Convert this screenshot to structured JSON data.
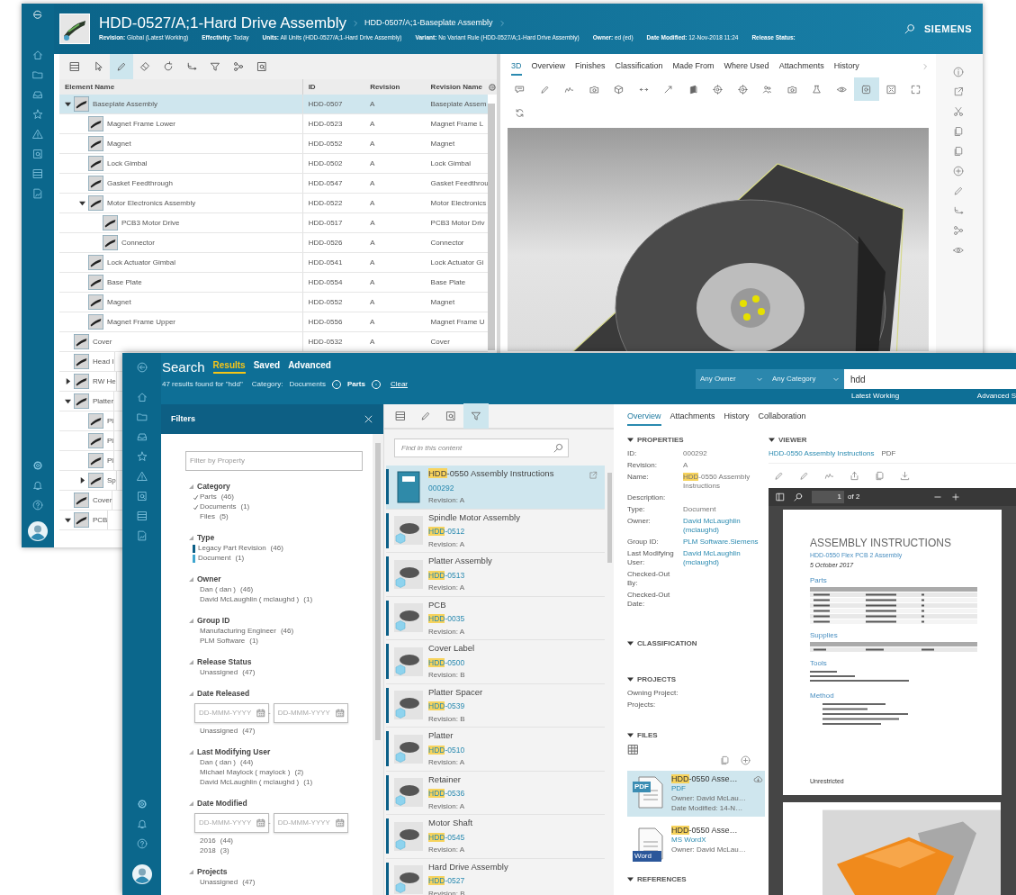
{
  "back_window": {
    "title": "HDD-0527/A;1-Hard Drive Assembly",
    "breadcrumb": "HDD-0507/A;1-Baseplate Assembly",
    "properties": [
      {
        "label": "Revision:",
        "value": "Global (Latest Working)"
      },
      {
        "label": "Effectivity:",
        "value": "Today"
      },
      {
        "label": "Units:",
        "value": "All Units (HDD-0527/A;1-Hard Drive Assembly)"
      },
      {
        "label": "Variant:",
        "value": "No Variant Rule (HDD-0527/A;1-Hard Drive Assembly)"
      },
      {
        "label": "Owner:",
        "value": "ed (ed)"
      },
      {
        "label": "Date Modified:",
        "value": "12-Nov-2018 11:24"
      },
      {
        "label": "Release Status:"
      }
    ],
    "brand": "SIEMENS",
    "toolbar": [
      {
        "selected": false
      },
      {
        "selected": false
      },
      {
        "selected": true
      },
      {
        "selected": false
      },
      {
        "selected": false
      },
      {
        "selected": false
      },
      {
        "selected": false
      },
      {
        "selected": false
      },
      {
        "selected": false
      }
    ],
    "table": {
      "columns": [
        "Element Name",
        "ID",
        "Revision",
        "Revision Name"
      ],
      "rows": [
        {
          "name": "Baseplate Assembly",
          "id": "HDD-0507",
          "revision": "A",
          "revision_name": "Baseplate Assem",
          "selected": true,
          "expanded": true,
          "children": [
            {
              "name": "Magnet Frame Lower",
              "id": "HDD-0523",
              "revision": "A",
              "revision_name": "Magnet Frame L",
              "selected": false
            },
            {
              "name": "Magnet",
              "id": "HDD-0552",
              "revision": "A",
              "revision_name": "Magnet",
              "selected": false
            },
            {
              "name": "Lock Gimbal",
              "id": "HDD-0502",
              "revision": "A",
              "revision_name": "Lock Gimbal",
              "selected": false
            },
            {
              "name": "Gasket Feedthrough",
              "id": "HDD-0547",
              "revision": "A",
              "revision_name": "Gasket Feedthrou",
              "selected": false
            },
            {
              "name": "Motor Electronics Assembly",
              "id": "HDD-0522",
              "revision": "A",
              "revision_name": "Motor Electronics",
              "selected": false,
              "expanded": true,
              "children": [
                {
                  "name": "PCB3 Motor Drive",
                  "id": "HDD-0517",
                  "revision": "A",
                  "revision_name": "PCB3 Motor Driv",
                  "selected": false
                },
                {
                  "name": "Connector",
                  "id": "HDD-0526",
                  "revision": "A",
                  "revision_name": "Connector",
                  "selected": false
                }
              ]
            },
            {
              "name": "Lock Actuator Gimbal",
              "id": "HDD-0541",
              "revision": "A",
              "revision_name": "Lock Actuator Gi",
              "selected": false
            },
            {
              "name": "Base Plate",
              "id": "HDD-0554",
              "revision": "A",
              "revision_name": "Base Plate",
              "selected": false
            },
            {
              "name": "Magnet",
              "id": "HDD-0552",
              "revision": "A",
              "revision_name": "Magnet",
              "selected": false
            },
            {
              "name": "Magnet Frame Upper",
              "id": "HDD-0556",
              "revision": "A",
              "revision_name": "Magnet Frame U",
              "selected": false
            }
          ]
        },
        {
          "name": "Cover",
          "id": "HDD-0532",
          "revision": "A",
          "revision_name": "Cover",
          "selected": false
        },
        {
          "name": "Head I",
          "selected": false
        },
        {
          "name": "RW He",
          "selected": false,
          "expanded": false
        },
        {
          "name": "Platter",
          "selected": false,
          "expanded": true,
          "children": [
            {
              "name": "Pl",
              "selected": false
            },
            {
              "name": "Pl",
              "selected": false
            },
            {
              "name": "Pl",
              "selected": false
            },
            {
              "name": "Sp",
              "selected": false,
              "expanded": false
            }
          ]
        },
        {
          "name": "Cover",
          "selected": false
        },
        {
          "name": "PCB",
          "selected": false,
          "expanded": true
        }
      ]
    },
    "tabs": [
      {
        "label": "3D",
        "selected": true
      },
      {
        "label": "Overview",
        "selected": false
      },
      {
        "label": "Finishes",
        "selected": false
      },
      {
        "label": "Classification",
        "selected": false
      },
      {
        "label": "Made From",
        "selected": false
      },
      {
        "label": "Where Used",
        "selected": false
      },
      {
        "label": "Attachments",
        "selected": false
      },
      {
        "label": "History",
        "selected": false
      }
    ],
    "viewer_toolbar": [
      {
        "selected": false
      },
      {
        "selected": false
      },
      {
        "selected": false
      },
      {
        "selected": false
      },
      {
        "selected": false
      },
      {
        "selected": false
      },
      {
        "selected": false
      },
      {
        "selected": false
      },
      {
        "selected": false
      },
      {
        "selected": false
      },
      {
        "selected": false
      },
      {
        "selected": false
      },
      {
        "selected": false
      },
      {
        "selected": false
      },
      {
        "selected": true
      },
      {
        "selected": false
      },
      {
        "selected": false
      },
      {
        "selected": false
      }
    ]
  },
  "search_window": {
    "title": "Search",
    "tabs": [
      {
        "label": "Results",
        "selected": true
      },
      {
        "label": "Saved",
        "selected": false
      },
      {
        "label": "Advanced",
        "selected": false
      }
    ],
    "summary": "47 results found for \"hdd\"",
    "category_label": "Category:",
    "chips": [
      "Documents",
      "Parts"
    ],
    "clear": "Clear",
    "owner_dropdown": "Any Owner",
    "category_dropdown": "Any Category",
    "search_value": "hdd",
    "revision_rule": "Latest Working",
    "advanced_link": "Advanced S",
    "filters": {
      "title": "Filters",
      "placeholder": "Filter by Property",
      "sections": [
        {
          "title": "Category",
          "kind": "checklist",
          "items": [
            {
              "label": "Parts",
              "count": "(46)",
              "checked": true
            },
            {
              "label": "Documents",
              "count": "(1)",
              "checked": true
            },
            {
              "label": "Files",
              "count": "(5)",
              "checked": false
            }
          ]
        },
        {
          "title": "Type",
          "kind": "colorlist",
          "items": [
            {
              "label": "Legacy Part Revision",
              "count": "(46)",
              "color": "#0b5f87"
            },
            {
              "label": "Document",
              "count": "(1)",
              "color": "#3fa6cf"
            }
          ]
        },
        {
          "title": "Owner",
          "kind": "list",
          "items": [
            {
              "label": "Dan ( dan )",
              "count": "(46)"
            },
            {
              "label": "David McLaughlin ( mclaughd )",
              "count": "(1)"
            }
          ]
        },
        {
          "title": "Group ID",
          "kind": "list",
          "items": [
            {
              "label": "Manufacturing Engineer",
              "count": "(46)"
            },
            {
              "label": "PLM Software",
              "count": "(1)"
            }
          ]
        },
        {
          "title": "Release Status",
          "kind": "list",
          "items": [
            {
              "label": "Unassigned",
              "count": "(47)"
            }
          ]
        },
        {
          "title": "Date Released",
          "kind": "daterange",
          "from_placeholder": "DD-MMM-YYYY",
          "separator": "-",
          "to_placeholder": "DD-MMM-YYYY",
          "items": [
            {
              "label": "Unassigned",
              "count": "(47)"
            }
          ]
        },
        {
          "title": "Last Modifying User",
          "kind": "list",
          "items": [
            {
              "label": "Dan ( dan )",
              "count": "(44)"
            },
            {
              "label": "Michael Maylock ( maylock )",
              "count": "(2)"
            },
            {
              "label": "David McLaughlin ( mclaughd )",
              "count": "(1)"
            }
          ]
        },
        {
          "title": "Date Modified",
          "kind": "daterange",
          "from_placeholder": "DD-MMM-YYYY",
          "separator": "-",
          "to_placeholder": "DD-MMM-YYYY",
          "items": [
            {
              "label": "2016",
              "count": "(44)"
            },
            {
              "label": "2018",
              "count": "(3)"
            }
          ]
        },
        {
          "title": "Projects",
          "kind": "list",
          "items": [
            {
              "label": "Unassigned",
              "count": "(47)"
            }
          ]
        }
      ]
    },
    "results_toolbar": [
      {
        "selected": false
      },
      {
        "selected": false
      },
      {
        "selected": false
      },
      {
        "selected": true
      }
    ],
    "find_placeholder": "Find in this content",
    "results": [
      {
        "kind": "document",
        "title": "**HDD**-0550 Assembly Instructions",
        "id": "000292",
        "revision_label": "Revision:",
        "revision": "A",
        "selected": true
      },
      {
        "kind": "part",
        "title": "Spindle Motor Assembly",
        "id": "**HDD**-0512",
        "revision_label": "Revision:",
        "revision": "A",
        "selected": false
      },
      {
        "kind": "part",
        "title": "Platter Assembly",
        "id": "**HDD**-0513",
        "revision_label": "Revision:",
        "revision": "A",
        "selected": false
      },
      {
        "kind": "part",
        "title": "PCB",
        "id": "**HDD**-0035",
        "revision_label": "Revision:",
        "revision": "A",
        "selected": false
      },
      {
        "kind": "part",
        "title": "Cover Label",
        "id": "**HDD**-0500",
        "revision_label": "Revision:",
        "revision": "B",
        "selected": false
      },
      {
        "kind": "part",
        "title": "Platter Spacer",
        "id": "**HDD**-0539",
        "revision_label": "Revision:",
        "revision": "B",
        "selected": false
      },
      {
        "kind": "part",
        "title": "Platter",
        "id": "**HDD**-0510",
        "revision_label": "Revision:",
        "revision": "A",
        "selected": false
      },
      {
        "kind": "part",
        "title": "Retainer",
        "id": "**HDD**-0536",
        "revision_label": "Revision:",
        "revision": "A",
        "selected": false
      },
      {
        "kind": "part",
        "title": "Motor Shaft",
        "id": "**HDD**-0545",
        "revision_label": "Revision:",
        "revision": "A",
        "selected": false
      },
      {
        "kind": "part",
        "title": "Hard Drive Assembly",
        "id": "**HDD**-0527",
        "revision_label": "Revision:",
        "revision": "B",
        "selected": false
      }
    ],
    "detail": {
      "tabs": [
        {
          "label": "Overview",
          "selected": true
        },
        {
          "label": "Attachments",
          "selected": false
        },
        {
          "label": "History",
          "selected": false
        },
        {
          "label": "Collaboration",
          "selected": false
        }
      ],
      "properties": {
        "title": "PROPERTIES",
        "rows": [
          {
            "label": "ID:",
            "value": "000292",
            "kind": "text"
          },
          {
            "label": "Revision:",
            "value": "A",
            "kind": "text"
          },
          {
            "label": "Name:",
            "value": "**HDD**-0550 Assembly Instructions",
            "kind": "text"
          },
          {
            "label": "Description:"
          },
          {
            "label": "Type:",
            "value": "Document",
            "kind": "text"
          },
          {
            "label": "Owner:",
            "value": "David McLaughlin (mclaughd)",
            "kind": "link"
          },
          {
            "label": "Group ID:",
            "value": "PLM Software.Siemens",
            "kind": "link"
          },
          {
            "label": "Last Modifying User:",
            "value": "David McLaughlin (mclaughd)",
            "kind": "link"
          },
          {
            "label": "Checked-Out By:"
          },
          {
            "label": "Checked-Out Date:"
          }
        ]
      },
      "classification": {
        "title": "CLASSIFICATION"
      },
      "projects": {
        "title": "PROJECTS",
        "rows": [
          {
            "label": "Owning Project:"
          },
          {
            "label": "Projects:"
          }
        ]
      },
      "files": {
        "title": "FILES",
        "items": [
          {
            "kind": "pdf",
            "badge": "PDF",
            "name": "**HDD**-0550 Asse…",
            "type": "PDF",
            "owner": "Owner: David McLau…",
            "date": "Date Modified: 14-N…",
            "selected": true
          },
          {
            "kind": "word",
            "badge": "Word",
            "name": "**HDD**-0550 Asse…",
            "type": "MS WordX",
            "owner": "Owner: David McLau…",
            "selected": false
          }
        ]
      },
      "references": {
        "title": "REFERENCES"
      },
      "viewer": {
        "title": "VIEWER",
        "file_link": "HDD-0550 Assembly Instructions",
        "file_type": "PDF",
        "page": "1",
        "page_count": "of 2",
        "document": {
          "heading": "ASSEMBLY INSTRUCTIONS",
          "subtitle": "HDD-0550 Flex PCB 2 Assembly",
          "date": "5 October 2017",
          "sections": [
            "Parts",
            "Supplies",
            "Tools",
            "Method"
          ],
          "footer": "Unrestricted"
        }
      }
    }
  }
}
